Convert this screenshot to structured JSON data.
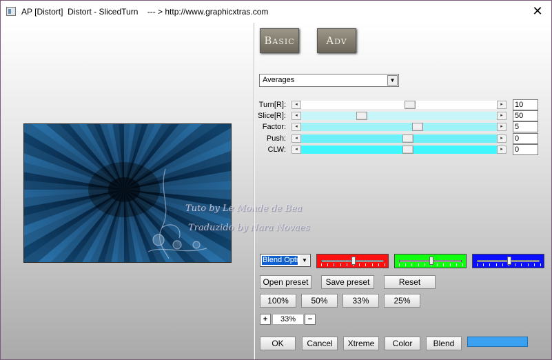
{
  "window": {
    "title": "AP [Distort]  Distort - SlicedTurn    --- > http://www.graphicxtras.com",
    "close_glyph": "✕"
  },
  "tabs": {
    "basic_label": "Basic",
    "adv_label": "Adv"
  },
  "mode": {
    "value": "Averages",
    "arrow": "▼"
  },
  "sliders": [
    {
      "label": "Turn[R]:",
      "value": "10",
      "level": 0.56,
      "track_color": "#ffffff"
    },
    {
      "label": "Slice[R]:",
      "value": "50",
      "level": 0.3,
      "track_color": "#c8f6f8"
    },
    {
      "label": "Factor:",
      "value": "5",
      "level": 0.6,
      "track_color": "#9ff2f6"
    },
    {
      "label": "Push:",
      "value": "0",
      "level": 0.55,
      "track_color": "#6ef0f8"
    },
    {
      "label": "CLW:",
      "value": "0",
      "level": 0.55,
      "track_color": "#40f6ff"
    }
  ],
  "arrows": {
    "left": "◂",
    "right": "▸"
  },
  "blend": {
    "value": "Blend Opti",
    "arrow": "▼"
  },
  "color_sliders": [
    {
      "name": "red",
      "color": "#ff1010",
      "level": 0.5
    },
    {
      "name": "green",
      "color": "#10ff10",
      "level": 0.5
    },
    {
      "name": "blue",
      "color": "#0a10ff",
      "level": 0.5
    }
  ],
  "preset_buttons": {
    "open": "Open preset",
    "save": "Save preset",
    "reset": "Reset"
  },
  "zoom_buttons": [
    "100%",
    "50%",
    "33%",
    "25%"
  ],
  "zoom": {
    "plus": "+",
    "value": "33%",
    "minus": "−"
  },
  "action_buttons": {
    "ok": "OK",
    "cancel": "Cancel",
    "xtreme": "Xtreme",
    "color": "Color",
    "blend": "Blend"
  },
  "swatch_color": "#3aa0f0",
  "watermark": {
    "line1": "Tuto by Le Monde de Bea",
    "line2": "Traduzido by Nara Novaes"
  }
}
